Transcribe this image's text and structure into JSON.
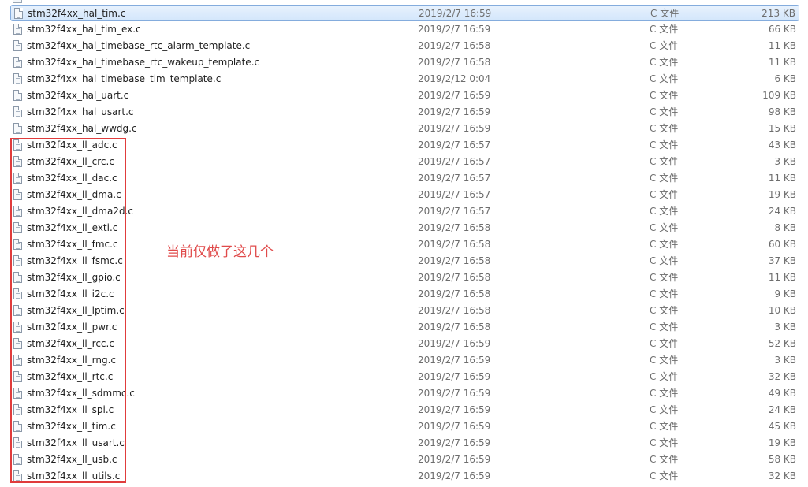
{
  "files": [
    {
      "name": "stm32f4xx_hal_tim.c",
      "date": "2019/2/7 16:59",
      "type": "C 文件",
      "size": "213 KB",
      "selected": true
    },
    {
      "name": "stm32f4xx_hal_tim_ex.c",
      "date": "2019/2/7 16:59",
      "type": "C 文件",
      "size": "66 KB"
    },
    {
      "name": "stm32f4xx_hal_timebase_rtc_alarm_template.c",
      "date": "2019/2/7 16:58",
      "type": "C 文件",
      "size": "11 KB"
    },
    {
      "name": "stm32f4xx_hal_timebase_rtc_wakeup_template.c",
      "date": "2019/2/7 16:58",
      "type": "C 文件",
      "size": "11 KB"
    },
    {
      "name": "stm32f4xx_hal_timebase_tim_template.c",
      "date": "2019/2/12 0:04",
      "type": "C 文件",
      "size": "6 KB"
    },
    {
      "name": "stm32f4xx_hal_uart.c",
      "date": "2019/2/7 16:59",
      "type": "C 文件",
      "size": "109 KB"
    },
    {
      "name": "stm32f4xx_hal_usart.c",
      "date": "2019/2/7 16:59",
      "type": "C 文件",
      "size": "98 KB"
    },
    {
      "name": "stm32f4xx_hal_wwdg.c",
      "date": "2019/2/7 16:59",
      "type": "C 文件",
      "size": "15 KB"
    },
    {
      "name": "stm32f4xx_ll_adc.c",
      "date": "2019/2/7 16:57",
      "type": "C 文件",
      "size": "43 KB"
    },
    {
      "name": "stm32f4xx_ll_crc.c",
      "date": "2019/2/7 16:57",
      "type": "C 文件",
      "size": "3 KB"
    },
    {
      "name": "stm32f4xx_ll_dac.c",
      "date": "2019/2/7 16:57",
      "type": "C 文件",
      "size": "11 KB"
    },
    {
      "name": "stm32f4xx_ll_dma.c",
      "date": "2019/2/7 16:57",
      "type": "C 文件",
      "size": "19 KB"
    },
    {
      "name": "stm32f4xx_ll_dma2d.c",
      "date": "2019/2/7 16:57",
      "type": "C 文件",
      "size": "24 KB"
    },
    {
      "name": "stm32f4xx_ll_exti.c",
      "date": "2019/2/7 16:58",
      "type": "C 文件",
      "size": "8 KB"
    },
    {
      "name": "stm32f4xx_ll_fmc.c",
      "date": "2019/2/7 16:58",
      "type": "C 文件",
      "size": "60 KB"
    },
    {
      "name": "stm32f4xx_ll_fsmc.c",
      "date": "2019/2/7 16:58",
      "type": "C 文件",
      "size": "37 KB"
    },
    {
      "name": "stm32f4xx_ll_gpio.c",
      "date": "2019/2/7 16:58",
      "type": "C 文件",
      "size": "11 KB"
    },
    {
      "name": "stm32f4xx_ll_i2c.c",
      "date": "2019/2/7 16:58",
      "type": "C 文件",
      "size": "9 KB"
    },
    {
      "name": "stm32f4xx_ll_lptim.c",
      "date": "2019/2/7 16:58",
      "type": "C 文件",
      "size": "10 KB"
    },
    {
      "name": "stm32f4xx_ll_pwr.c",
      "date": "2019/2/7 16:58",
      "type": "C 文件",
      "size": "3 KB"
    },
    {
      "name": "stm32f4xx_ll_rcc.c",
      "date": "2019/2/7 16:59",
      "type": "C 文件",
      "size": "52 KB"
    },
    {
      "name": "stm32f4xx_ll_rng.c",
      "date": "2019/2/7 16:59",
      "type": "C 文件",
      "size": "3 KB"
    },
    {
      "name": "stm32f4xx_ll_rtc.c",
      "date": "2019/2/7 16:59",
      "type": "C 文件",
      "size": "32 KB"
    },
    {
      "name": "stm32f4xx_ll_sdmmc.c",
      "date": "2019/2/7 16:59",
      "type": "C 文件",
      "size": "49 KB"
    },
    {
      "name": "stm32f4xx_ll_spi.c",
      "date": "2019/2/7 16:59",
      "type": "C 文件",
      "size": "24 KB"
    },
    {
      "name": "stm32f4xx_ll_tim.c",
      "date": "2019/2/7 16:59",
      "type": "C 文件",
      "size": "45 KB"
    },
    {
      "name": "stm32f4xx_ll_usart.c",
      "date": "2019/2/7 16:59",
      "type": "C 文件",
      "size": "19 KB"
    },
    {
      "name": "stm32f4xx_ll_usb.c",
      "date": "2019/2/7 16:59",
      "type": "C 文件",
      "size": "58 KB"
    },
    {
      "name": "stm32f4xx_ll_utils.c",
      "date": "2019/2/7 16:59",
      "type": "C 文件",
      "size": "32 KB"
    }
  ],
  "annotation": {
    "text": "当前仅做了这几个",
    "color": "#e04b4b"
  },
  "highlight": {
    "color": "#e03c3c"
  },
  "icons": {
    "file": "c-source-file-icon"
  }
}
